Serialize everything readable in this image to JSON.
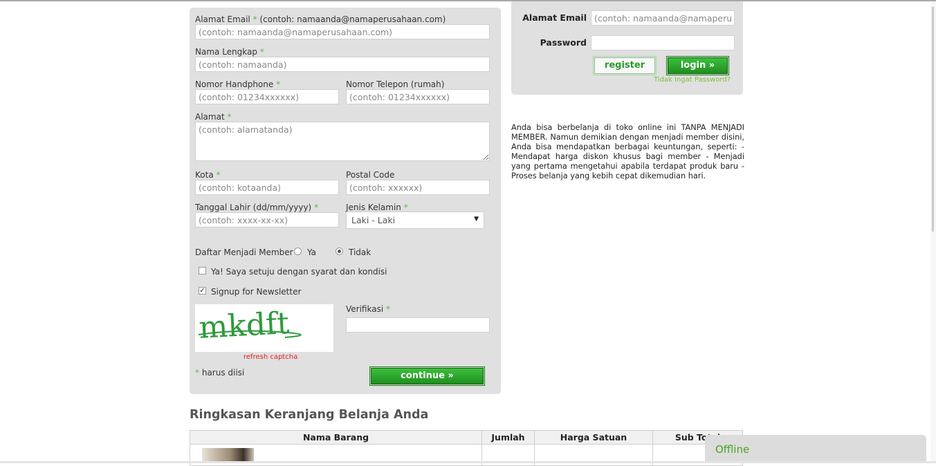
{
  "registration": {
    "email_label": "Alamat Email",
    "email_hint": "(contoh: namaanda@namaperusahaan.com)",
    "email_placeholder": "(contoh: namaanda@namaperusahaan.com)",
    "name_label": "Nama Lengkap",
    "name_placeholder": "(contoh: namaanda)",
    "mobile_label": "Nomor Handphone",
    "mobile_placeholder": "(contoh: 01234xxxxxx)",
    "phone_label": "Nomor Telepon (rumah)",
    "phone_placeholder": "(contoh: 01234xxxxxx)",
    "address_label": "Alamat",
    "address_placeholder": "(contoh: alamatanda)",
    "city_label": "Kota",
    "city_placeholder": "(contoh: kotaanda)",
    "postal_label": "Postal Code",
    "postal_placeholder": "(contoh: xxxxxx)",
    "dob_label": "Tanggal Lahir (dd/mm/yyyy)",
    "dob_placeholder": "(contoh: xxxx-xx-xx)",
    "gender_label": "Jenis Kelamin",
    "gender_value": "Laki - Laki",
    "member_label": "Daftar Menjadi Member ?",
    "member_yes": "Ya",
    "member_no": "Tidak",
    "member_selected": "Tidak",
    "terms_label": "Ya! Saya setuju dengan syarat dan kondisi",
    "terms_checked": false,
    "newsletter_label": "Signup for Newsletter",
    "newsletter_checked": true,
    "captcha_text": "mkdft",
    "refresh_captcha": "refresh captcha",
    "verification_label": "Verifikasi",
    "required_note": "harus diisi",
    "required_mark": "*",
    "continue_label": "continue »"
  },
  "login": {
    "email_label": "Alamat Email",
    "email_placeholder": "(contoh: namaanda@namaperusahaan.com)",
    "password_label": "Password",
    "register_label": "register",
    "login_label": "login »",
    "forgot_label": "Tidak Ingat Password?"
  },
  "info_text": "Anda bisa berbelanja di toko online ini TANPA MENJADI MEMBER. Namun demikian dengan menjadi member disini, Anda bisa mendapatkan berbagai keuntungan, seperti: - Mendapat harga diskon khusus bagi member - Menjadi yang pertama mengetahui apabila terdapat produk baru - Proses belanja yang kebih cepat dikemudian hari.",
  "cart": {
    "title": "Ringkasan Keranjang Belanja Anda",
    "columns": [
      "Nama Barang",
      "Jumlah",
      "Harga Satuan",
      "Sub Total"
    ]
  },
  "chat": {
    "status": "Offline"
  },
  "colors": {
    "accent_green": "#2aa12a",
    "required_green": "#55b948",
    "panel_gray": "#e0e0e0",
    "link_red": "#e02020"
  }
}
